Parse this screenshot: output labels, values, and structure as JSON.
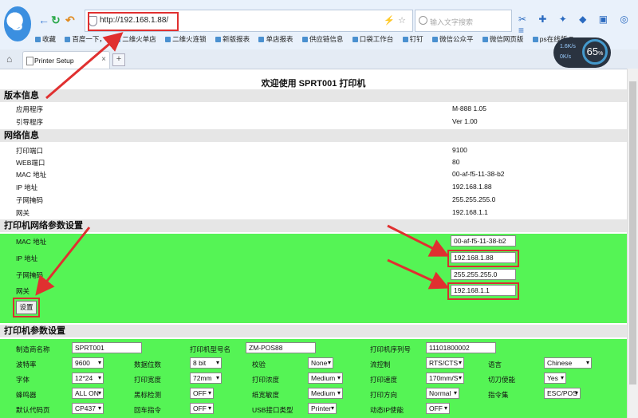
{
  "browser": {
    "url": "http://192.168.1.88/",
    "search_placeholder": "输入文字搜索",
    "bookmarks": [
      "收藏",
      "百度一下，",
      "二维火单店",
      "二维火连锁",
      "新版报表",
      "单店报表",
      "供应链信息",
      "口袋工作台",
      "钉钉",
      "微信公众平",
      "微信网页版",
      "ps在线版 P"
    ],
    "tab_title": "Printer Setup",
    "speed_up": "1.6K/s",
    "speed_down": "0K/s",
    "cpu_percent": "65",
    "cpu_unit": "%"
  },
  "page": {
    "title": "欢迎使用 SPRT001 打印机",
    "version_section": {
      "heading": "版本信息",
      "rows": [
        {
          "label": "应用程序",
          "value": "M-888 1.05"
        },
        {
          "label": "引导程序",
          "value": "Ver 1.00"
        }
      ]
    },
    "network_section": {
      "heading": "网络信息",
      "rows": [
        {
          "label": "打印端口",
          "value": "9100"
        },
        {
          "label": "WEB端口",
          "value": "80"
        },
        {
          "label": "MAC 地址",
          "value": "00-af-f5-11-38-b2"
        },
        {
          "label": "IP 地址",
          "value": "192.168.1.88"
        },
        {
          "label": "子网掩码",
          "value": "255.255.255.0"
        },
        {
          "label": "网关",
          "value": "192.168.1.1"
        }
      ]
    },
    "netparam_section": {
      "heading": "打印机网络参数设置",
      "fields": [
        {
          "label": "MAC 地址",
          "value": "00-af-f5-11-38-b2"
        },
        {
          "label": "IP 地址",
          "value": "192.168.1.88"
        },
        {
          "label": "子网掩码",
          "value": "255.255.255.0"
        },
        {
          "label": "网关",
          "value": "192.168.1.1"
        }
      ],
      "submit_label": "设置"
    },
    "printparam_section": {
      "heading": "打印机参数设置",
      "rows": [
        [
          {
            "label": "制造商名称",
            "kind": "input",
            "value": "SPRT001"
          },
          {
            "label": "打印机型号名",
            "kind": "input",
            "value": "ZM-POS88"
          },
          {
            "label": "打印机序列号",
            "kind": "input",
            "value": "11101800002"
          }
        ],
        [
          {
            "label": "波特率",
            "kind": "select",
            "value": "9600"
          },
          {
            "label": "数据位数",
            "kind": "select",
            "value": "8 bit"
          },
          {
            "label": "校验",
            "kind": "select",
            "value": "None"
          },
          {
            "label": "流控制",
            "kind": "select",
            "value": "RTS/CTS"
          },
          {
            "label": "语言",
            "kind": "select",
            "value": "Chinese"
          }
        ],
        [
          {
            "label": "字体",
            "kind": "select",
            "value": "12*24"
          },
          {
            "label": "打印宽度",
            "kind": "select",
            "value": "72mm"
          },
          {
            "label": "打印浓度",
            "kind": "select",
            "value": "Medium"
          },
          {
            "label": "打印速度",
            "kind": "select",
            "value": "170mm/S"
          },
          {
            "label": "切刀使能",
            "kind": "select",
            "value": "Yes"
          }
        ],
        [
          {
            "label": "蜂鸣器",
            "kind": "select",
            "value": "ALL ON"
          },
          {
            "label": "黑标检测",
            "kind": "select",
            "value": "OFF"
          },
          {
            "label": "纸宽敏度",
            "kind": "select",
            "value": "Medium"
          },
          {
            "label": "打印方向",
            "kind": "select",
            "value": "Normal"
          },
          {
            "label": "指令集",
            "kind": "select",
            "value": "ESC/POS"
          }
        ],
        [
          {
            "label": "默认代码页",
            "kind": "select",
            "value": "CP437"
          },
          {
            "label": "回车指令",
            "kind": "select",
            "value": "OFF"
          },
          {
            "label": "USB接口类型",
            "kind": "select",
            "value": "Printer"
          },
          {
            "label": "动态IP使能",
            "kind": "select",
            "value": "OFF"
          }
        ]
      ]
    }
  },
  "colors": {
    "green_panel": "#55f455",
    "annotation_red": "#d83030",
    "section_gray": "#e6e6e6"
  }
}
